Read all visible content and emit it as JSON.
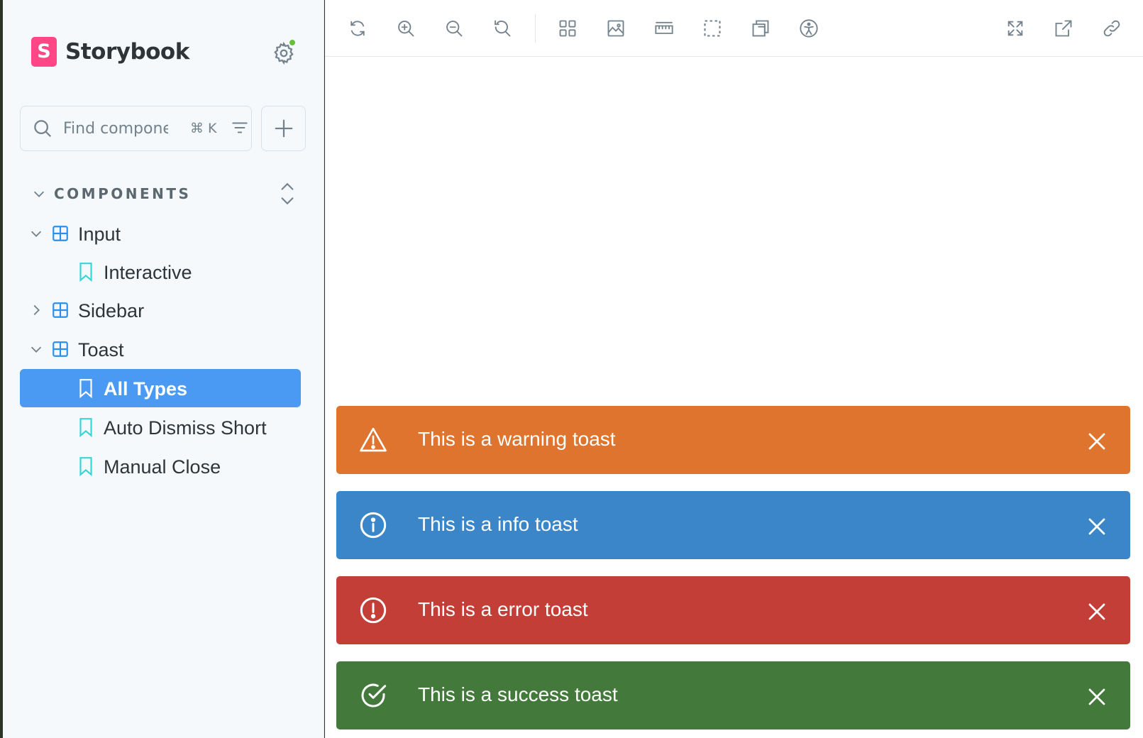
{
  "sidebar": {
    "brand": {
      "logo_letter": "S",
      "name": "Storybook"
    },
    "search": {
      "placeholder": "Find components",
      "shortcut": "⌘ K"
    },
    "section": {
      "label": "COMPONENTS"
    },
    "tree": [
      {
        "label": "Input",
        "kind": "component",
        "expanded": true
      },
      {
        "label": "Interactive",
        "kind": "story"
      },
      {
        "label": "Sidebar",
        "kind": "component",
        "expanded": false
      },
      {
        "label": "Toast",
        "kind": "component",
        "expanded": true
      },
      {
        "label": "All Types",
        "kind": "story",
        "selected": true
      },
      {
        "label": "Auto Dismiss Short",
        "kind": "story"
      },
      {
        "label": "Manual Close",
        "kind": "story"
      }
    ]
  },
  "toolbar": {
    "left_icons": [
      "reload-icon",
      "zoom-in-icon",
      "zoom-out-icon",
      "zoom-reset-icon",
      "grid-icon",
      "background-icon",
      "measure-icon",
      "outline-icon",
      "viewport-icon",
      "accessibility-icon"
    ],
    "right_icons": [
      "fullscreen-icon",
      "open-new-tab-icon",
      "copy-link-icon"
    ]
  },
  "toasts": [
    {
      "type": "warning",
      "message": "This is a warning toast",
      "color": "#de742e"
    },
    {
      "type": "info",
      "message": "This is a info toast",
      "color": "#3b86c9"
    },
    {
      "type": "error",
      "message": "This is a error toast",
      "color": "#c43e38"
    },
    {
      "type": "success",
      "message": "This is a success toast",
      "color": "#437a3b"
    }
  ],
  "colors": {
    "sidebar_bg": "#f6f9fc",
    "selected_bg": "#4a9af4",
    "component_icon": "#2a90ee",
    "story_icon": "#37d5d3",
    "brand": "#ff4785"
  }
}
